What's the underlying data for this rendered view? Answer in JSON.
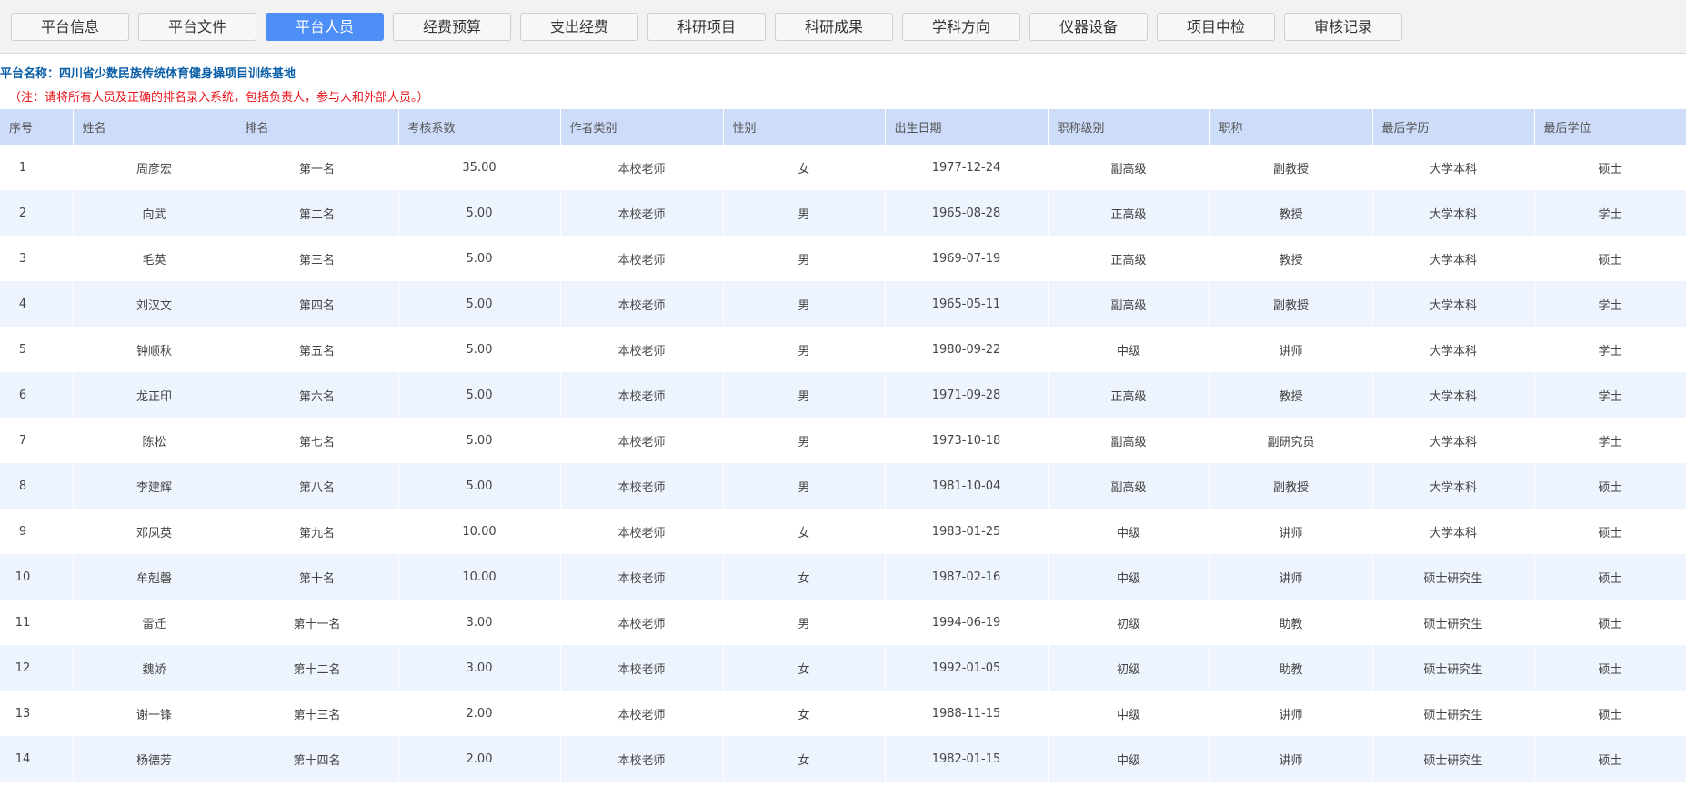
{
  "tabs": [
    {
      "label": "平台信息",
      "active": false
    },
    {
      "label": "平台文件",
      "active": false
    },
    {
      "label": "平台人员",
      "active": true
    },
    {
      "label": "经费预算",
      "active": false
    },
    {
      "label": "支出经费",
      "active": false
    },
    {
      "label": "科研项目",
      "active": false
    },
    {
      "label": "科研成果",
      "active": false
    },
    {
      "label": "学科方向",
      "active": false
    },
    {
      "label": "仪器设备",
      "active": false
    },
    {
      "label": "项目中检",
      "active": false
    },
    {
      "label": "审核记录",
      "active": false
    }
  ],
  "platform": {
    "label": "平台名称：",
    "name": "四川省少数民族传统体育健身操项目训练基地"
  },
  "note": "（注：请将所有人员及正确的排名录入系统，包括负责人，参与人和外部人员。）",
  "table": {
    "columns": [
      "序号",
      "姓名",
      "排名",
      "考核系数",
      "作者类别",
      "性别",
      "出生日期",
      "职称级别",
      "职称",
      "最后学历",
      "最后学位"
    ],
    "rows": [
      [
        "1",
        "周彦宏",
        "第一名",
        "35.00",
        "本校老师",
        "女",
        "1977-12-24",
        "副高级",
        "副教授",
        "大学本科",
        "硕士"
      ],
      [
        "2",
        "向武",
        "第二名",
        "5.00",
        "本校老师",
        "男",
        "1965-08-28",
        "正高级",
        "教授",
        "大学本科",
        "学士"
      ],
      [
        "3",
        "毛英",
        "第三名",
        "5.00",
        "本校老师",
        "男",
        "1969-07-19",
        "正高级",
        "教授",
        "大学本科",
        "硕士"
      ],
      [
        "4",
        "刘汉文",
        "第四名",
        "5.00",
        "本校老师",
        "男",
        "1965-05-11",
        "副高级",
        "副教授",
        "大学本科",
        "学士"
      ],
      [
        "5",
        "钟顺秋",
        "第五名",
        "5.00",
        "本校老师",
        "男",
        "1980-09-22",
        "中级",
        "讲师",
        "大学本科",
        "学士"
      ],
      [
        "6",
        "龙正印",
        "第六名",
        "5.00",
        "本校老师",
        "男",
        "1971-09-28",
        "正高级",
        "教授",
        "大学本科",
        "学士"
      ],
      [
        "7",
        "陈松",
        "第七名",
        "5.00",
        "本校老师",
        "男",
        "1973-10-18",
        "副高级",
        "副研究员",
        "大学本科",
        "学士"
      ],
      [
        "8",
        "李建辉",
        "第八名",
        "5.00",
        "本校老师",
        "男",
        "1981-10-04",
        "副高级",
        "副教授",
        "大学本科",
        "硕士"
      ],
      [
        "9",
        "邓凤英",
        "第九名",
        "10.00",
        "本校老师",
        "女",
        "1983-01-25",
        "中级",
        "讲师",
        "大学本科",
        "硕士"
      ],
      [
        "10",
        "牟剋磬",
        "第十名",
        "10.00",
        "本校老师",
        "女",
        "1987-02-16",
        "中级",
        "讲师",
        "硕士研究生",
        "硕士"
      ],
      [
        "11",
        "雷迁",
        "第十一名",
        "3.00",
        "本校老师",
        "男",
        "1994-06-19",
        "初级",
        "助教",
        "硕士研究生",
        "硕士"
      ],
      [
        "12",
        "魏娇",
        "第十二名",
        "3.00",
        "本校老师",
        "女",
        "1992-01-05",
        "初级",
        "助教",
        "硕士研究生",
        "硕士"
      ],
      [
        "13",
        "谢一锋",
        "第十三名",
        "2.00",
        "本校老师",
        "女",
        "1988-11-15",
        "中级",
        "讲师",
        "硕士研究生",
        "硕士"
      ],
      [
        "14",
        "杨德芳",
        "第十四名",
        "2.00",
        "本校老师",
        "女",
        "1982-01-15",
        "中级",
        "讲师",
        "硕士研究生",
        "硕士"
      ]
    ]
  }
}
